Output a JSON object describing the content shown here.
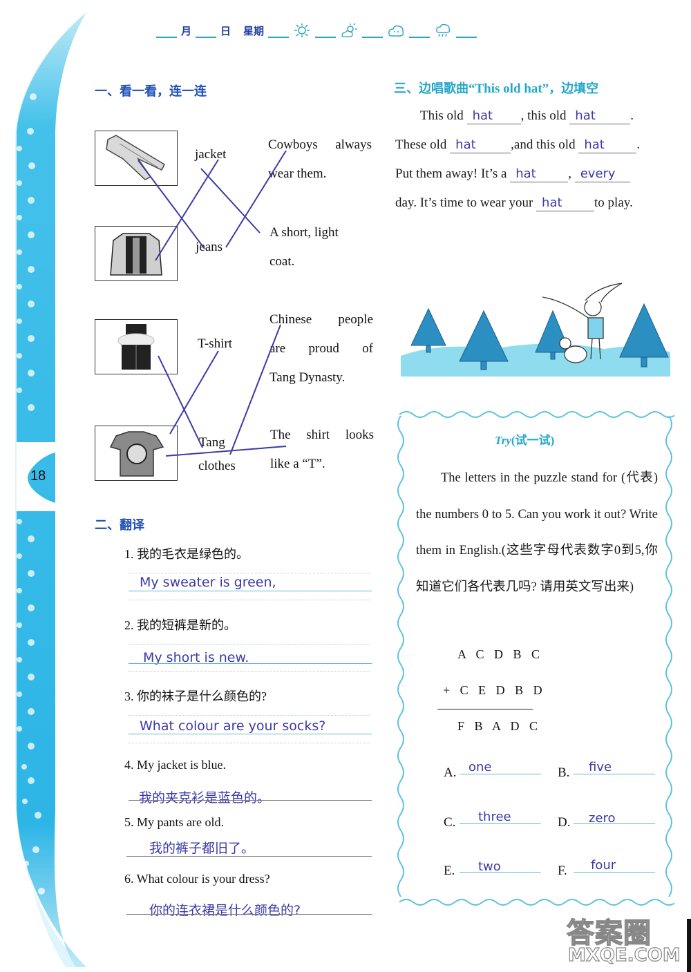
{
  "header": {
    "month_label": "月",
    "day_label": "日",
    "weekday_label": "星期",
    "weather_icons": [
      "sunny-icon",
      "partly-sunny-icon",
      "cloudy-icon",
      "rainy-icon"
    ]
  },
  "page_number": "18",
  "section1": {
    "title": "一、看一看，连一连",
    "pictures": [
      "jeans-picture",
      "jacket-picture",
      "tang-clothes-picture",
      "t-shirt-picture"
    ],
    "words": [
      "jacket",
      "jeans",
      "T-shirt",
      "Tang",
      "clothes"
    ],
    "descriptions": [
      {
        "lines": [
          "Cowboys always",
          "wear them."
        ]
      },
      {
        "lines": [
          "A short, light",
          "coat."
        ]
      },
      {
        "lines": [
          "Chinese people",
          "are proud of",
          "Tang Dynasty."
        ]
      },
      {
        "lines": [
          "The shirt looks",
          "like a “T”."
        ]
      }
    ]
  },
  "section2": {
    "title": "二、翻译",
    "items": [
      {
        "question": "1. 我的毛衣是绿色的。",
        "answer": "My sweater is green,"
      },
      {
        "question": "2. 我的短裤是新的。",
        "answer": "My short is new."
      },
      {
        "question": "3. 你的袜子是什么颜色的?",
        "answer": "What colour are your socks?"
      },
      {
        "question": "4. My jacket is blue.",
        "answer": "我的夹克衫是蓝色的。"
      },
      {
        "question": "5. My pants are old.",
        "answer": "我的裤子都旧了。"
      },
      {
        "question": "6. What colour is your dress?",
        "answer": "你的连衣裙是什么颜色的?"
      }
    ]
  },
  "section3": {
    "title_prefix": "三、边唱歌曲",
    "title_song": "“This old hat”",
    "title_suffix": "，边填空",
    "lines": [
      {
        "t1": "This old ",
        "a1": "hat",
        "t2": ", this old ",
        "a2": "hat",
        "t3": "."
      },
      {
        "t1": "These old ",
        "a1": "hat",
        "t2": ",and this old ",
        "a2": "hat",
        "t3": "."
      },
      {
        "t1": "Put them away!  It’s a ",
        "a1": "hat",
        "t2": ", ",
        "a2": "every",
        "t3": ""
      },
      {
        "t1": "day. It’s time to wear your ",
        "a1": "hat",
        "t2": "to play.",
        "a2": "",
        "t3": ""
      }
    ]
  },
  "try": {
    "title_en": "Try",
    "title_cn": "(试一试)",
    "text": "The letters in the puzzle stand for (代表) the numbers 0 to 5. Can you work it out? Write them in English.(这些字母代表数字0到5,你知道它们各代表几吗? 请用英文写出来)",
    "equation": {
      "line1": "A C D B C",
      "line2": "+ C E D B D",
      "result": "F B A D C"
    },
    "answers": [
      {
        "label": "A.",
        "value": "one"
      },
      {
        "label": "B.",
        "value": "five"
      },
      {
        "label": "C.",
        "value": "three"
      },
      {
        "label": "D.",
        "value": "zero"
      },
      {
        "label": "E.",
        "value": "two"
      },
      {
        "label": "F.",
        "value": "four"
      }
    ]
  },
  "watermark": {
    "line1": "答案圈",
    "line2": "MXQE.COM"
  },
  "colors": {
    "band": "#29b6e6",
    "answer_ink": "#3b3aa8",
    "heading_blue": "#1e4fb8",
    "heading_cyan": "#23a7c9",
    "match_line": "#3a3aa6"
  }
}
